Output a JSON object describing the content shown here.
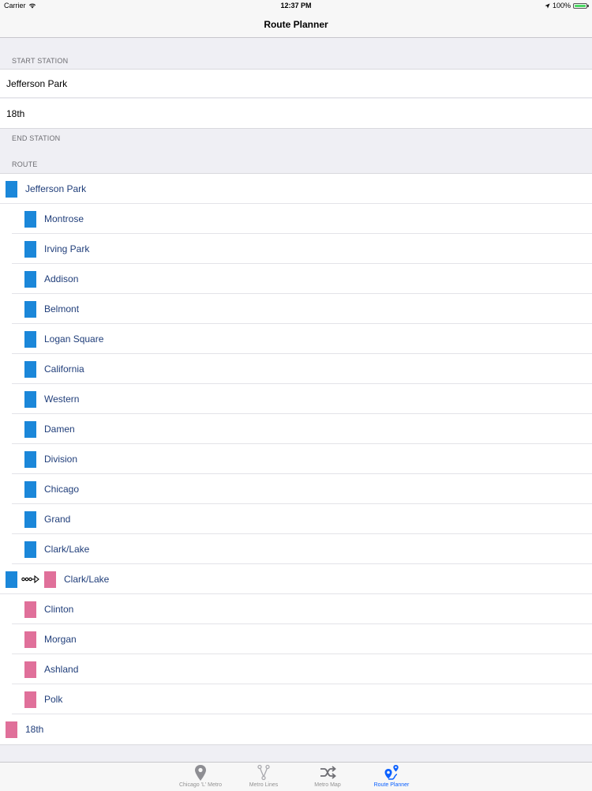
{
  "status_bar": {
    "carrier": "Carrier",
    "time": "12:37 PM",
    "battery": "100%"
  },
  "nav": {
    "title": "Route Planner"
  },
  "sections": {
    "start_header": "START STATION",
    "end_header": "END STATION",
    "route_header": "ROUTE"
  },
  "fields": {
    "start_value": "Jefferson Park",
    "end_value": "18th"
  },
  "colors": {
    "blue_line": "#1b87d9",
    "pink_line": "#e0709a",
    "active_tab": "#0a60ff",
    "inactive_tab": "#929292"
  },
  "route": {
    "origin": {
      "label": "Jefferson Park",
      "line": "blue"
    },
    "blue_stops": [
      "Montrose",
      "Irving Park",
      "Addison",
      "Belmont",
      "Logan Square",
      "California",
      "Western",
      "Damen",
      "Division",
      "Chicago",
      "Grand",
      "Clark/Lake"
    ],
    "transfer": {
      "label": "Clark/Lake",
      "from_line": "blue",
      "to_line": "pink",
      "icon": "transfer-arrow-icon"
    },
    "pink_stops": [
      "Clinton",
      "Morgan",
      "Ashland",
      "Polk"
    ],
    "destination": {
      "label": "18th",
      "line": "pink"
    }
  },
  "tabs": [
    {
      "label": "Chicago 'L' Metro",
      "icon": "map-pin-icon",
      "active": false
    },
    {
      "label": "Metro Lines",
      "icon": "branch-lines-icon",
      "active": false
    },
    {
      "label": "Metro Map",
      "icon": "shuffle-icon",
      "active": false
    },
    {
      "label": "Route Planner",
      "icon": "route-planner-icon",
      "active": true
    }
  ]
}
